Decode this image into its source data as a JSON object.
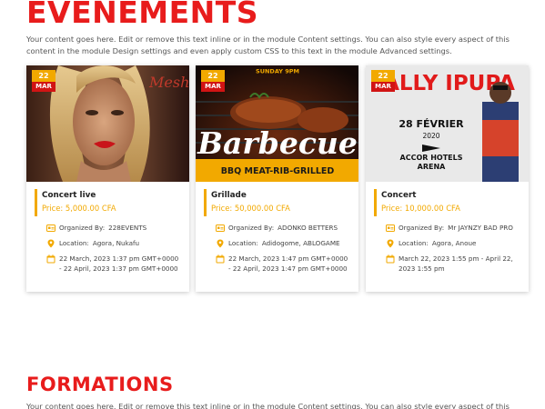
{
  "events": {
    "title": "EVENEMENTS",
    "intro": "Your content goes here. Edit or remove this text inline or in the module Content settings. You can also style every aspect of this content in the module Design settings and even apply custom CSS to this text in the module Advanced settings.",
    "organized_label": "Organized By:",
    "location_label": "Location:",
    "items": [
      {
        "day": "22",
        "month": "MAR",
        "image_text": "",
        "name": "Concert live",
        "price": "Price: 5,000.00 CFA",
        "organizer": "228EVENTS",
        "location": "Agora, Nukafu",
        "dates": "22 March, 2023 1:37 pm GMT+0000 - 22 April, 2023 1:37 pm GMT+0000"
      },
      {
        "day": "22",
        "month": "MAR",
        "image_text": "SUNDAY 9PM",
        "image_title": "Barbecue",
        "image_subtitle": "BBQ MEAT-RIB-GRILLED",
        "name": "Grillade",
        "price": "Price: 50,000.00 CFA",
        "organizer": "ADONKO BETTERS",
        "location": "Adidogome, ABLOGAME",
        "dates": "22 March, 2023 1:47 pm GMT+0000 - 22 April, 2023 1:47 pm GMT+0000"
      },
      {
        "day": "22",
        "month": "MAR",
        "image_title": "FALLY IPUPA",
        "image_date": "28 FÉVRIER",
        "image_year": "2020",
        "image_venue_1": "ACCOR HOTELS",
        "image_venue_2": "ARENA",
        "name": "Concert",
        "price": "Price: 10,000.00 CFA",
        "organizer": "Mr JAYNZY BAD PRO",
        "location": "Agora, Anoue",
        "dates": "March 22, 2023 1:55 pm - April 22, 2023 1:55 pm"
      }
    ]
  },
  "formations": {
    "title": "FORMATIONS",
    "intro": "Your content goes here. Edit or remove this text inline or in the module Content settings. You can also style every aspect of this content in the"
  },
  "colors": {
    "accent": "#f2a900",
    "brand_red": "#e81c1c",
    "badge_red": "#d11414"
  },
  "icons": {
    "organizer": "id-card-icon",
    "location": "map-pin-icon",
    "date": "calendar-icon"
  }
}
